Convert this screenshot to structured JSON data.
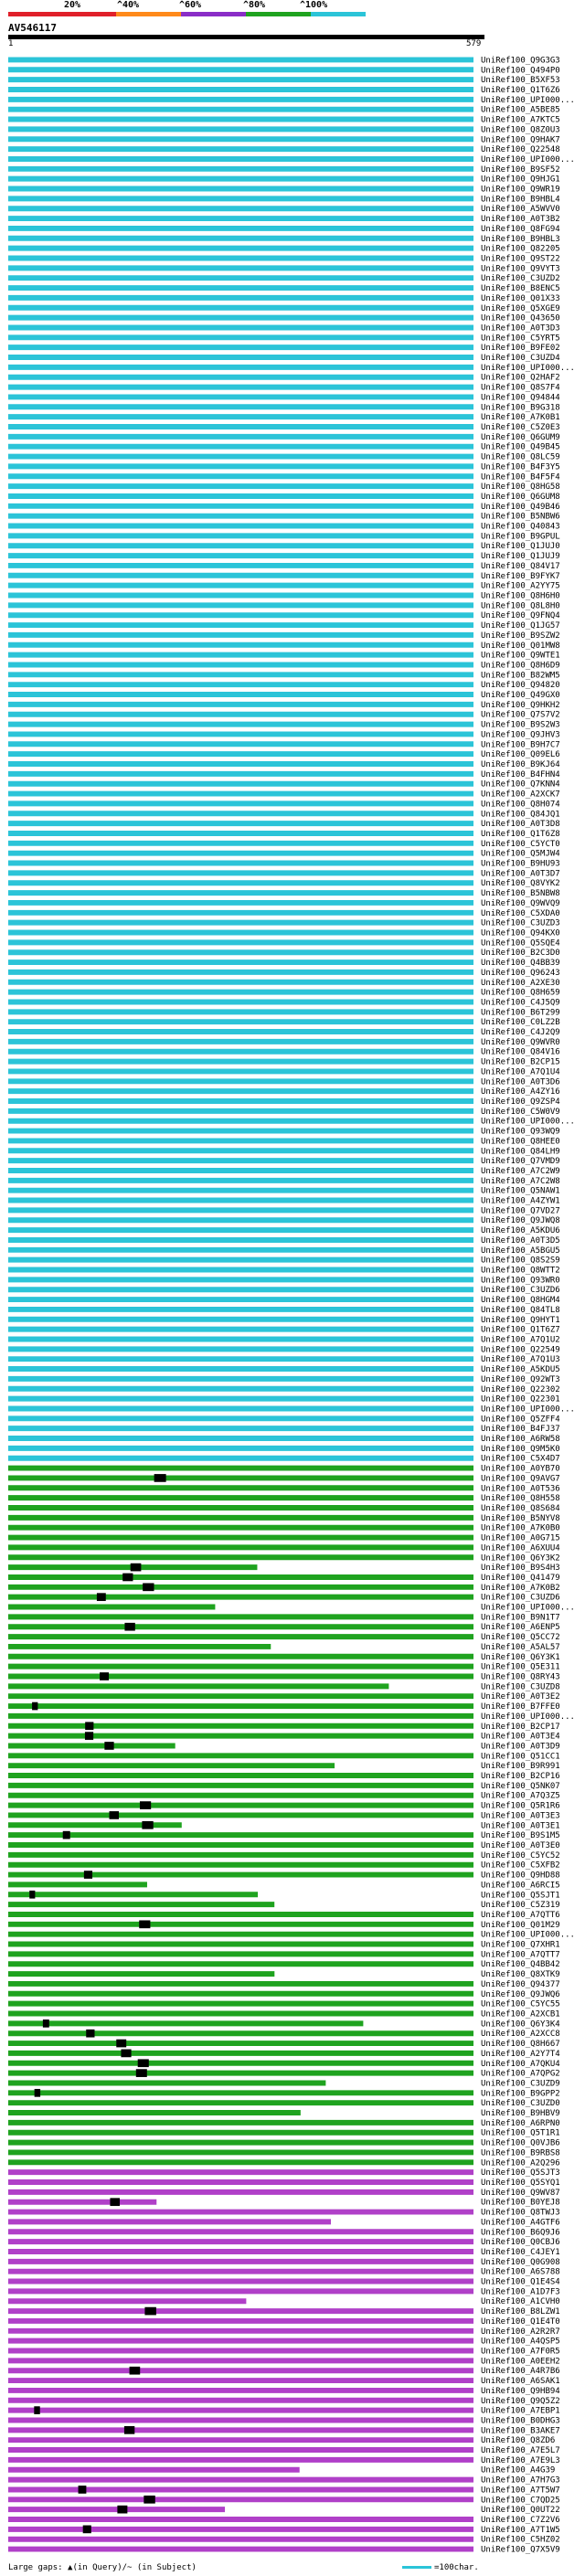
{
  "scale": {
    "labels": [
      "20%",
      "^40%",
      "^60%",
      "^80%",
      "^100%"
    ],
    "colors": [
      "#e0202a",
      "#ff8a1a",
      "#8a2dc7",
      "#1fa31f",
      "#2bc4d8"
    ]
  },
  "query": {
    "title": "AV546117",
    "start": "1",
    "end": "579"
  },
  "colors": {
    "identity_100": "#2bc4d8",
    "identity_80": "#1fa31f",
    "identity_60": "#b040c8",
    "gap": "#000000"
  },
  "hits": [
    "UniRef100_Q9G3G3",
    "UniRef100_Q494P0",
    "UniRef100_B5XF53",
    "UniRef100_Q1T6Z6",
    "UniRef100_UPI000...",
    "UniRef100_A5BE85",
    "UniRef100_A7KTC5",
    "UniRef100_Q8Z0U3",
    "UniRef100_Q9HAK7",
    "UniRef100_Q22548",
    "UniRef100_UPI000...",
    "UniRef100_B9SF52",
    "UniRef100_Q9HJG1",
    "UniRef100_Q9WR19",
    "UniRef100_B9HBL4",
    "UniRef100_A5WVV0",
    "UniRef100_A0T3B2",
    "UniRef100_Q8FG94",
    "UniRef100_B9HBL3",
    "UniRef100_Q82205",
    "UniRef100_Q9ST22",
    "UniRef100_Q9VYT3",
    "UniRef100_C3UZD2",
    "UniRef100_B8ENC5",
    "UniRef100_Q01X33",
    "UniRef100_Q5XGE9",
    "UniRef100_Q43650",
    "UniRef100_A0T3D3",
    "UniRef100_C5YRT5",
    "UniRef100_B9FE02",
    "UniRef100_C3UZD4",
    "UniRef100_UPI000...",
    "UniRef100_Q2HAF2",
    "UniRef100_Q8S7F4",
    "UniRef100_Q94844",
    "UniRef100_B9G318",
    "UniRef100_A7K0B1",
    "UniRef100_C5Z0E3",
    "UniRef100_Q6GUM9",
    "UniRef100_Q49B45",
    "UniRef100_Q8LC59",
    "UniRef100_B4F3Y5",
    "UniRef100_B4F5F4",
    "UniRef100_Q8HG58",
    "UniRef100_Q6GUM8",
    "UniRef100_Q49B46",
    "UniRef100_B5NBW6",
    "UniRef100_Q40843",
    "UniRef100_B9GPUL",
    "UniRef100_Q1JUJ0",
    "UniRef100_Q1JUJ9",
    "UniRef100_Q84V17",
    "UniRef100_B9FYK7",
    "UniRef100_A2YY75",
    "UniRef100_Q8H6H0",
    "UniRef100_Q8L8H0",
    "UniRef100_Q9FNQ4",
    "UniRef100_Q1JG57",
    "UniRef100_B9SZW2",
    "UniRef100_Q01MW8",
    "UniRef100_Q9WTE1",
    "UniRef100_Q8H6D9",
    "UniRef100_B82WM5",
    "UniRef100_Q94820",
    "UniRef100_Q49GX0",
    "UniRef100_Q9HKH2",
    "UniRef100_Q7S7V2",
    "UniRef100_B9S2W3",
    "UniRef100_Q9JHV3",
    "UniRef100_B9H7C7",
    "UniRef100_Q09EL6",
    "UniRef100_B9KJ64",
    "UniRef100_B4FHN4",
    "UniRef100_Q7KNN4",
    "UniRef100_A2XCK7",
    "UniRef100_Q8H074",
    "UniRef100_Q84JQ1",
    "UniRef100_A0T3D8",
    "UniRef100_Q1T6Z8",
    "UniRef100_C5YCT0",
    "UniRef100_Q5MJW4",
    "UniRef100_B9HU93",
    "UniRef100_A0T3D7",
    "UniRef100_Q8VYK2",
    "UniRef100_B5NBW8",
    "UniRef100_Q9WVQ9",
    "UniRef100_C5XDA0",
    "UniRef100_C3UZD3",
    "UniRef100_Q94KX0",
    "UniRef100_Q5SQE4",
    "UniRef100_B2C3D0",
    "UniRef100_Q4BB39",
    "UniRef100_Q96243",
    "UniRef100_A2XE30",
    "UniRef100_Q8H659",
    "UniRef100_C4J5Q9",
    "UniRef100_B6T299",
    "UniRef100_C0LZ2B",
    "UniRef100_C4J2Q9",
    "UniRef100_Q9WVR0",
    "UniRef100_Q84V16",
    "UniRef100_B2CP15",
    "UniRef100_A7Q1U4",
    "UniRef100_A0T3D6",
    "UniRef100_A4ZY16",
    "UniRef100_Q9ZSP4",
    "UniRef100_C5W0V9",
    "UniRef100_UPI000...",
    "UniRef100_Q93WQ9",
    "UniRef100_Q8HEE0",
    "UniRef100_Q84LH9",
    "UniRef100_Q7VMD9",
    "UniRef100_A7C2W9",
    "UniRef100_A7C2W8",
    "UniRef100_Q5NAW1",
    "UniRef100_A4ZYW1",
    "UniRef100_Q7VD27",
    "UniRef100_Q9JWQ8",
    "UniRef100_A5KDU6",
    "UniRef100_A0T3D5",
    "UniRef100_A5BGU5",
    "UniRef100_Q8S2S9",
    "UniRef100_Q8WTT2",
    "UniRef100_Q93WR0",
    "UniRef100_C3UZD6",
    "UniRef100_Q8HGM4",
    "UniRef100_Q84TL8",
    "UniRef100_Q9HYT1",
    "UniRef100_Q1T6Z7",
    "UniRef100_A7Q1U2",
    "UniRef100_Q22549",
    "UniRef100_A7Q1U3",
    "UniRef100_A5KDU5",
    "UniRef100_Q92WT3",
    "UniRef100_Q22302",
    "UniRef100_Q22301",
    "UniRef100_UPI000...",
    "UniRef100_Q5ZFF4",
    "UniRef100_B4FJ37",
    "UniRef100_A6RW58",
    "UniRef100_Q9M5K0",
    "UniRef100_C5X4D7",
    "UniRef100_A0YB70",
    "UniRef100_Q9AVG7",
    "UniRef100_A0T536",
    "UniRef100_Q8H558",
    "UniRef100_Q8S684",
    "UniRef100_B5NYV8",
    "UniRef100_A7K0B0",
    "UniRef100_A0G715",
    "UniRef100_A6XUU4",
    "UniRef100_Q6Y3K2",
    "UniRef100_B9S4H3",
    "UniRef100_Q41479",
    "UniRef100_A7K0B2",
    "UniRef100_C3UZD6",
    "UniRef100_UPI000...",
    "UniRef100_B9N1T7",
    "UniRef100_A6ENP5",
    "UniRef100_Q5CC72",
    "UniRef100_A5AL57",
    "UniRef100_Q6Y3K1",
    "UniRef100_Q5E311",
    "UniRef100_Q8RY43",
    "UniRef100_C3UZD8",
    "UniRef100_A0T3E2",
    "UniRef100_B7FFE0",
    "UniRef100_UPI000...",
    "UniRef100_B2CP17",
    "UniRef100_A0T3E4",
    "UniRef100_A0T3D9",
    "UniRef100_Q51CC1",
    "UniRef100_B9R991",
    "UniRef100_B2CP16",
    "UniRef100_Q5NK07",
    "UniRef100_A7Q3Z5",
    "UniRef100_Q5R1R6",
    "UniRef100_A0T3E3",
    "UniRef100_A0T3E1",
    "UniRef100_B9S1M5",
    "UniRef100_A0T3E0",
    "UniRef100_C5YC52",
    "UniRef100_C5XFB2",
    "UniRef100_Q9HD88",
    "UniRef100_A6RCI5",
    "UniRef100_Q5SJT1",
    "UniRef100_C5Z319",
    "UniRef100_A7QTT6",
    "UniRef100_Q01M29",
    "UniRef100_UPI000...",
    "UniRef100_Q7XHR1",
    "UniRef100_A7QTT7",
    "UniRef100_Q4BB42",
    "UniRef100_Q8XTK9",
    "UniRef100_Q94377",
    "UniRef100_Q9JWQ6",
    "UniRef100_C5YC55",
    "UniRef100_A2XCB1",
    "UniRef100_Q6Y3K4",
    "UniRef100_A2XCC8",
    "UniRef100_Q8H667",
    "UniRef100_A2Y7T4",
    "UniRef100_A7QKU4",
    "UniRef100_A7QPG2",
    "UniRef100_C3UZD9",
    "UniRef100_B9GPP2",
    "UniRef100_C3UZD0",
    "UniRef100_B9HBV9",
    "UniRef100_A6RPN0",
    "UniRef100_Q5T1R1",
    "UniRef100_Q0VJB6",
    "UniRef100_B9RBS8",
    "UniRef100_A2Q296",
    "UniRef100_Q5SJT3",
    "UniRef100_Q5SYQ1",
    "UniRef100_Q9WV87",
    "UniRef100_B0YEJ8",
    "UniRef100_Q8TWJ3",
    "UniRef100_A4GTF6",
    "UniRef100_B6Q9J6",
    "UniRef100_Q0CBJ6",
    "UniRef100_C4JEY1",
    "UniRef100_Q0G908",
    "UniRef100_A6S788",
    "UniRef100_Q1E4S4",
    "UniRef100_A1D7F3",
    "UniRef100_A1CVH0",
    "UniRef100_B8LZW1",
    "UniRef100_Q1E4T0",
    "UniRef100_A2R2R7",
    "UniRef100_A4QSP5",
    "UniRef100_A7F0R5",
    "UniRef100_A0EEH2",
    "UniRef100_A4R7B6",
    "UniRef100_A6SAK1",
    "UniRef100_Q9HB94",
    "UniRef100_Q9Q5Z2",
    "UniRef100_A7EBP1",
    "UniRef100_B0DHG3",
    "UniRef100_B3AKE7",
    "UniRef100_Q8ZD6",
    "UniRef100_A7E5L7",
    "UniRef100_A7E9L3",
    "UniRef100_A4G39",
    "UniRef100_A7H7G3",
    "UniRef100_A7T5W7",
    "UniRef100_C7QD25",
    "UniRef100_Q0UT22",
    "UniRef100_C7Z2V6",
    "UniRef100_A7T1W5",
    "UniRef100_C5HZ02",
    "UniRef100_Q7X5V9"
  ],
  "footer": {
    "text": "Large gaps: ▲(in Query)/~ (in Subject)"
  },
  "legend": {
    "text": "=100char."
  }
}
